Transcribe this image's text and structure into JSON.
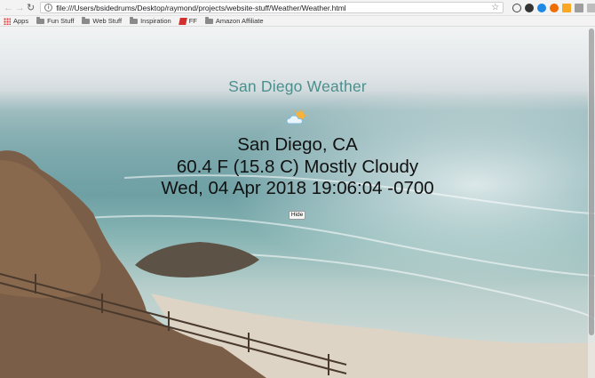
{
  "browser": {
    "url": "file:///Users/bsidedrums/Desktop/raymond/projects/website-stuff/Weather/Weather.html",
    "bookmarks": [
      {
        "label": "Apps",
        "icon": "apps-grid-icon"
      },
      {
        "label": "Fun Stuff",
        "icon": "folder-icon"
      },
      {
        "label": "Web Stuff",
        "icon": "folder-icon"
      },
      {
        "label": "Inspiration",
        "icon": "folder-icon"
      },
      {
        "label": "FF",
        "icon": "ff-icon"
      },
      {
        "label": "Amazon Affiliate",
        "icon": "folder-icon"
      }
    ]
  },
  "page": {
    "title": "San Diego Weather",
    "location": "San Diego, CA",
    "conditions": "60.4 F (15.8 C) Mostly Cloudy",
    "datetime": "Wed, 04 Apr 2018 19:06:04 -0700",
    "hide_label": "Hide",
    "weather_icon": "partly-cloudy-icon",
    "title_color": "#4b8f8c"
  }
}
